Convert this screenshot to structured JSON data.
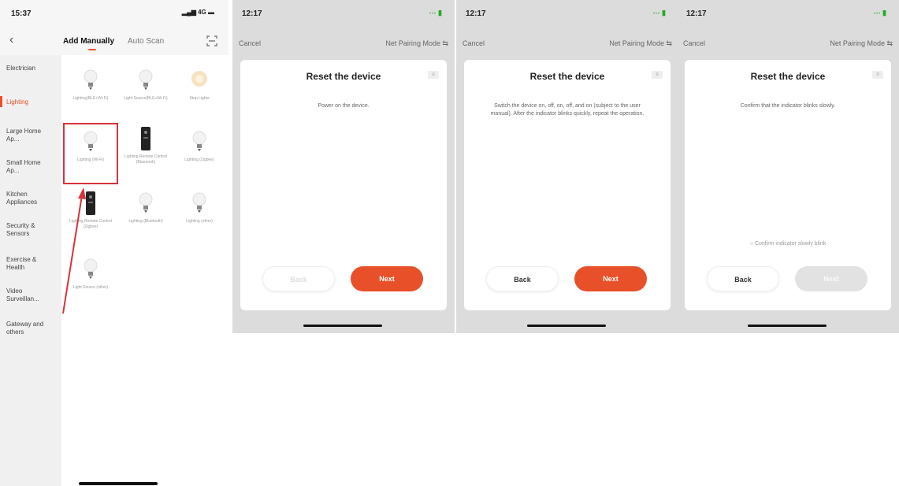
{
  "screen1": {
    "time": "15:37",
    "signal": "4G",
    "tabs": {
      "manual": "Add Manually",
      "auto": "Auto Scan"
    },
    "categories": [
      "Electrician",
      "Lighting",
      "Large Home Ap...",
      "Small Home Ap...",
      "Kitchen Appliances",
      "Security & Sensors",
      "Exercise & Health",
      "Video Surveillan...",
      "Gateway and others"
    ],
    "devices": [
      "Lighting(BLE+Wi-Fi)",
      "Light Source(BLE+Wi-Fi)",
      "Strip Lights",
      "Lighting (Wi-Fi)",
      "Lighting Remote Control (Bluetooth)",
      "Lighting (Zigbee)",
      "Lighting Remote Control (Zigbee)",
      "Lighting (Bluetooth)",
      "Lighting (other)",
      "Light Source (other)"
    ]
  },
  "screens": [
    {
      "time": "12:17",
      "cancel": "Cancel",
      "mode": "Net Pairing Mode ⇆",
      "title": "Reset the device",
      "description": "Power on the device.",
      "confirm": "",
      "back": "Back",
      "next": "Next"
    },
    {
      "time": "12:17",
      "cancel": "Cancel",
      "mode": "Net Pairing Mode ⇆",
      "title": "Reset the device",
      "description": "Switch the device on, off, on, off, and on (subject to the user manual). After the indicator blinks quickly, repeat the operation.",
      "confirm": "",
      "back": "Back",
      "next": "Next"
    },
    {
      "time": "12:17",
      "cancel": "Cancel",
      "mode": "Net Pairing Mode ⇆",
      "title": "Reset the device",
      "description": "Confirm that the indicator blinks slowly.",
      "confirm": "○ Confirm indicator slowly blink",
      "back": "Back",
      "next": "Next"
    }
  ],
  "colors": {
    "accent": "#e8502a",
    "highlight": "#d9323a"
  }
}
